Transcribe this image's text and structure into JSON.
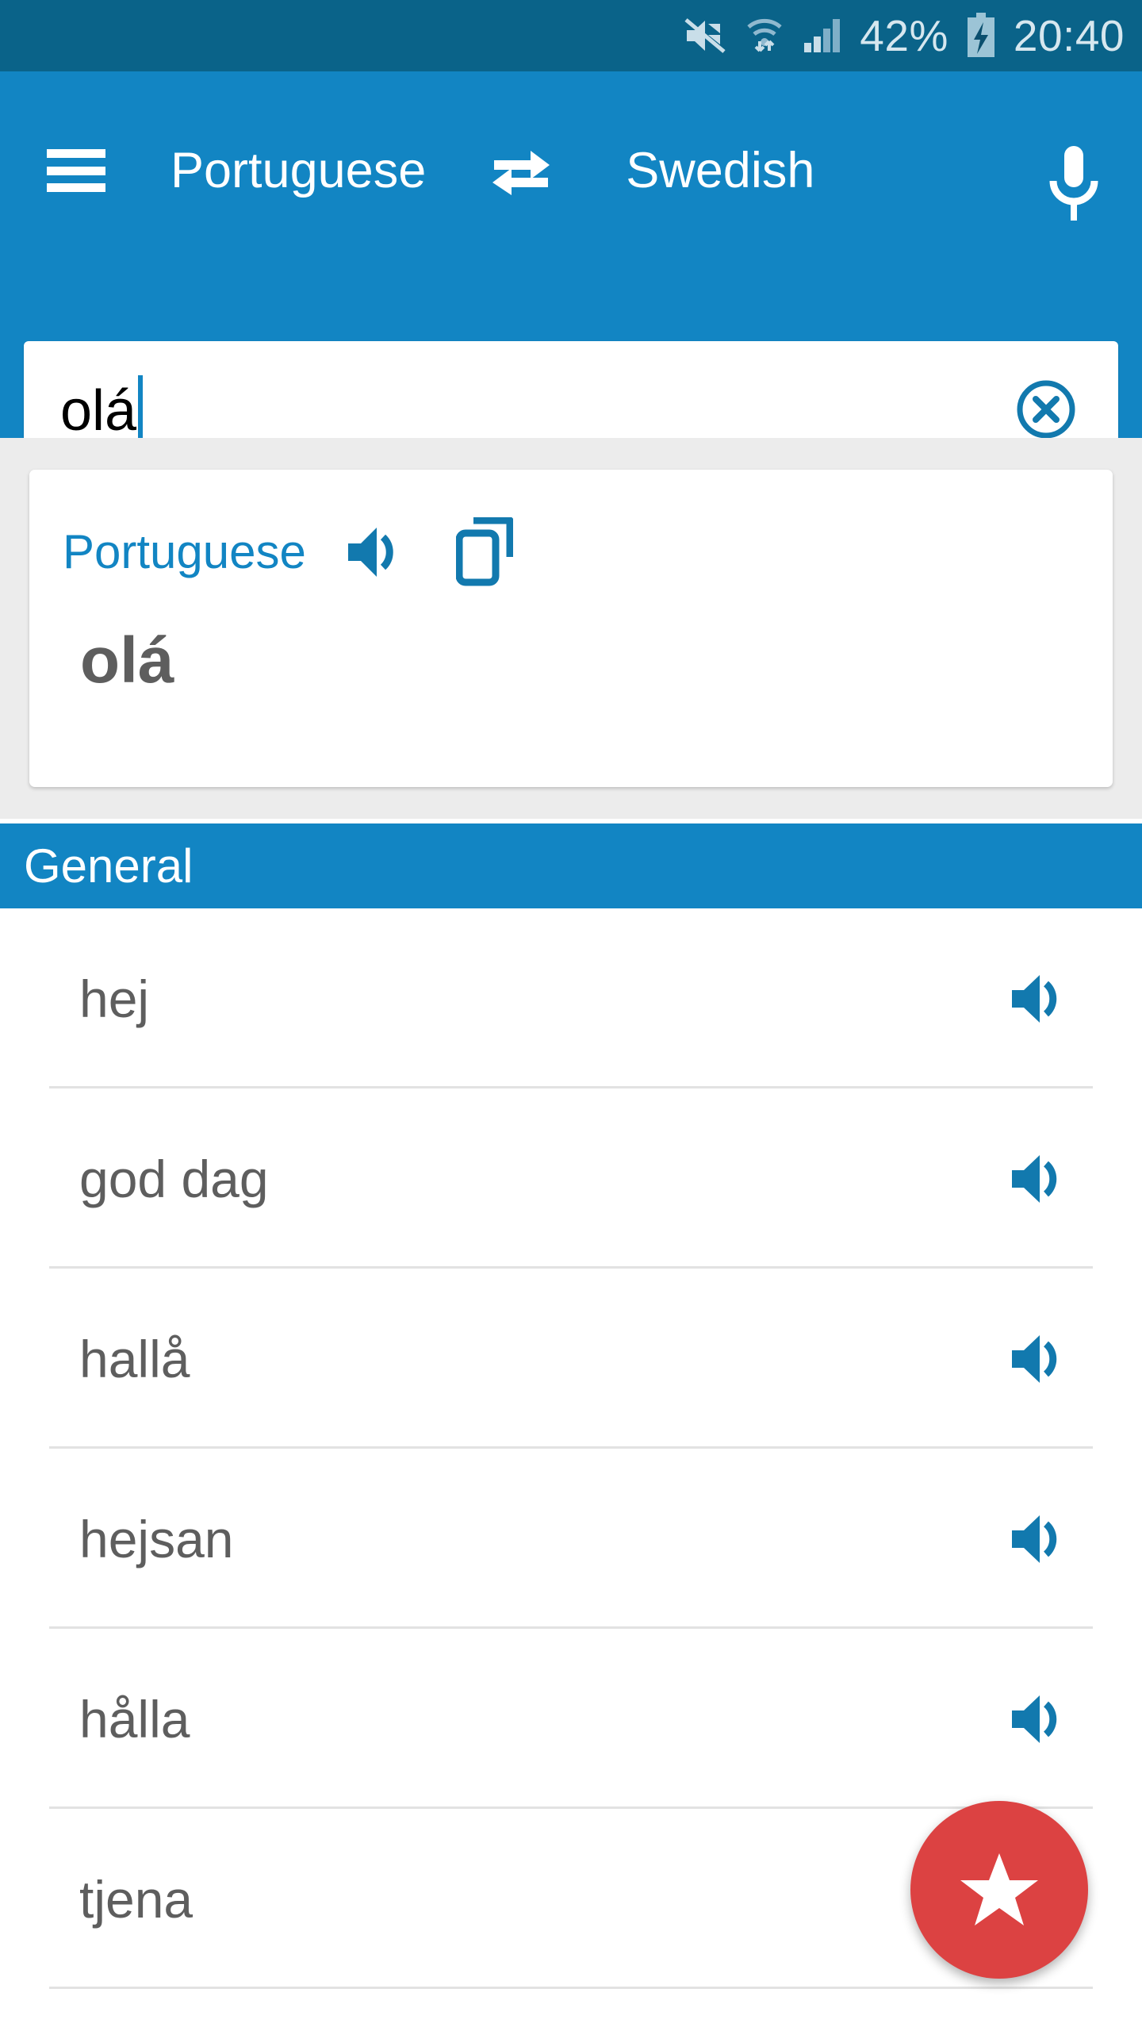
{
  "status_bar": {
    "battery_percent": "42%",
    "time": "20:40",
    "icons": [
      "mute-icon",
      "wifi-icon",
      "cellular-signal-icon",
      "battery-charging-icon"
    ]
  },
  "app_bar": {
    "menu_icon": "hamburger-menu-icon",
    "source_language": "Portuguese",
    "swap_icon": "swap-languages-icon",
    "target_language": "Swedish",
    "mic_icon": "microphone-icon"
  },
  "search": {
    "value": "olá",
    "placeholder": "",
    "clear_icon": "clear-circle-icon"
  },
  "result_card": {
    "language": "Portuguese",
    "speaker_icon": "speaker-icon",
    "copy_icon": "copy-icon",
    "word": "olá"
  },
  "section": {
    "title": "General"
  },
  "translations": [
    {
      "text": "hej",
      "speaker_icon": "speaker-icon"
    },
    {
      "text": "god dag",
      "speaker_icon": "speaker-icon"
    },
    {
      "text": "hallå",
      "speaker_icon": "speaker-icon"
    },
    {
      "text": "hejsan",
      "speaker_icon": "speaker-icon"
    },
    {
      "text": "hålla",
      "speaker_icon": "speaker-icon"
    },
    {
      "text": "tjena",
      "speaker_icon": "speaker-icon"
    }
  ],
  "fab": {
    "icon": "star-icon",
    "color": "#DC4242"
  },
  "colors": {
    "status_bar": "#0A6389",
    "app_bar": "#1285C3",
    "accent": "#1285C3",
    "card_zone": "#ECECEC",
    "text_gray": "#5E5E5E",
    "divider": "#E2E2E2",
    "fab_red": "#DC4242"
  }
}
